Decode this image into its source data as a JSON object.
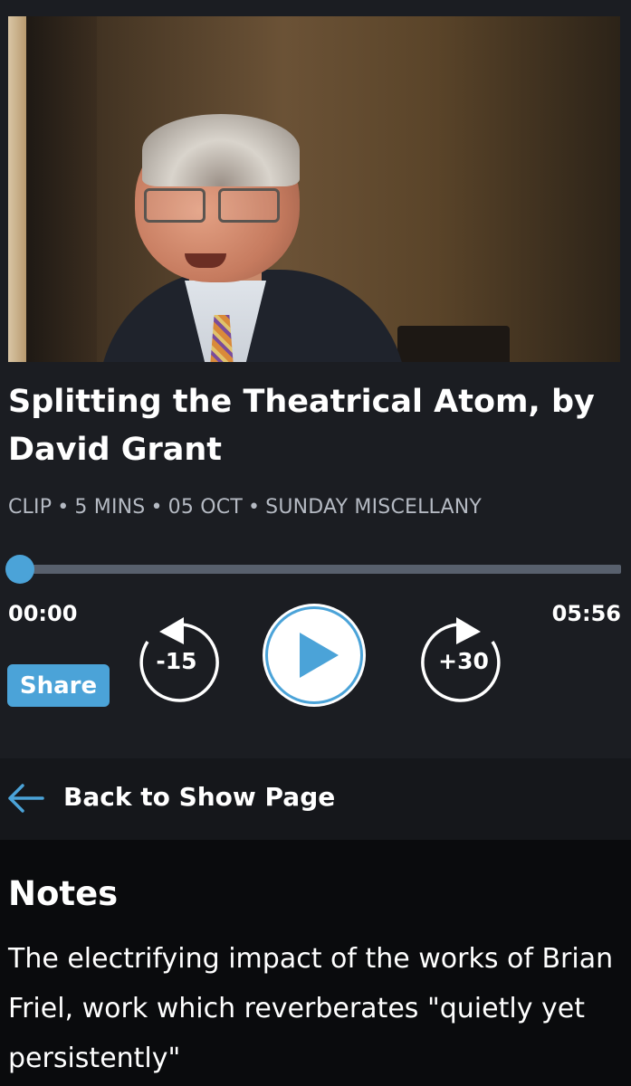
{
  "episode": {
    "title": "Splitting the Theatrical Atom, by David Grant",
    "meta": {
      "type": "CLIP",
      "duration": "5 MINS",
      "date": "05 OCT",
      "programme": "SUNDAY MISCELLANY",
      "separator": "•"
    }
  },
  "player": {
    "current_time": "00:00",
    "total_time": "05:56",
    "progress_fraction": 0,
    "skip_back_label": "-15",
    "skip_forward_label": "+30",
    "share_label": "Share",
    "accent_color": "#4ba3d8"
  },
  "navigation": {
    "back_label": "Back to Show Page"
  },
  "notes": {
    "heading": "Notes",
    "body": "The electrifying impact of the works of Brian Friel, work which reverberates \"quietly yet persistently\""
  },
  "icons": {
    "play": "play-icon",
    "skip_back": "rewind-15-icon",
    "skip_forward": "forward-30-icon",
    "back": "arrow-left-icon"
  }
}
